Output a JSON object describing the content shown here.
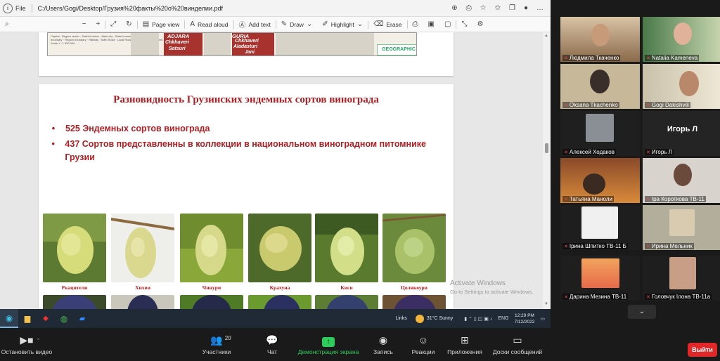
{
  "window": {
    "file_label": "File",
    "path": "C:/Users/Gogi/Desktop/Грузия%20факты%20о%20винделии.pdf"
  },
  "pdf_toolbar": {
    "page_view": "Page view",
    "read_aloud": "Read aloud",
    "add_text": "Add text",
    "draw": "Draw",
    "highlight": "Highlight",
    "erase": "Erase"
  },
  "map": {
    "legend": "Capital · Region center · District center · Main city · State boundary · Autonomous boundary · Region boundary · Railway · Main Road · Local Road · River · Lake · Vineyard",
    "scale": "Scale 1 : 1 650 000",
    "regions": [
      "ADJARA",
      "GURIA"
    ],
    "labels": [
      "Chkhaveri",
      "Satsuri",
      "Chkhaveri",
      "Aladasturi",
      "Jani"
    ],
    "logo": "GEOGRAPHIC"
  },
  "slide": {
    "title": "Разновидность Грузинских эндемных сортов винограда",
    "bullets": [
      "525 Эндемных сортов винограда",
      "437 Сортов представленны в коллекции в национальном виноградном питомнике Грузии"
    ],
    "grapes_row1": [
      "Ркацители",
      "Хихви",
      "Чинури",
      "Крахуна",
      "Киси",
      "Цоликоури"
    ],
    "colors": {
      "title": "#b01e23",
      "white_grape": "#c9d36a",
      "dark_grape": "#2c2f5e"
    }
  },
  "activation": {
    "line1": "Activate Windows",
    "line2": "Go to Settings to activate Windows."
  },
  "taskbar": {
    "links": "Links",
    "weather": "31°C  Sunny",
    "lang": "ENG",
    "time": "12:29 PM",
    "date": "7/12/2022"
  },
  "participants": [
    "Людмила Ткаченко",
    "Natalia Kameneva",
    "Oksana Tkachenko",
    "Gogi Dakishvili",
    "Алексей Ходаков",
    "Игорь Л",
    "Татьяна Маноли",
    "Іра Короткова ТВ-11",
    "Ірина Шпитко ТВ-11 Б",
    "Ирина Мельник",
    "Дарина Мезина ТВ-11",
    "Головчук Ілона ТВ-11а"
  ],
  "big_name": "Игорь Л",
  "zoom": {
    "stop_video": "Остановить видео",
    "participants": "Участники",
    "participants_count": "20",
    "chat": "Чат",
    "share": "Демонстрация экрана",
    "record": "Запись",
    "reactions": "Реакции",
    "apps": "Приложения",
    "whiteboards": "Доски сообщений",
    "leave": "Выйти"
  }
}
